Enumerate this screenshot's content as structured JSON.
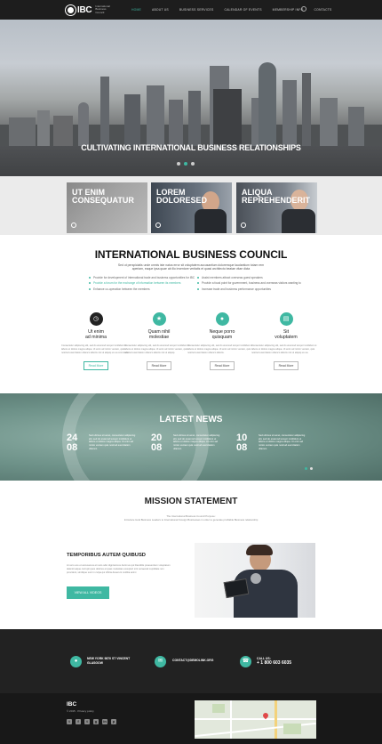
{
  "header": {
    "logo_text": "IBC",
    "logo_sub": "International Business Council",
    "nav": [
      "Home",
      "About us",
      "Business services",
      "Calendar of events",
      "Membership info",
      "Contacts"
    ]
  },
  "hero": {
    "caption": "CULTIVATING INTERNATIONAL BUSINESS RELATIONSHIPS"
  },
  "cards": [
    {
      "line1": "UT ENIM",
      "line2": "CONSEQUATUR"
    },
    {
      "line1": "LOREM",
      "line2": "DOLORESED"
    },
    {
      "line1": "ALIQUA",
      "line2": "REPREHENDERIT"
    }
  ],
  "intro": {
    "title": "INTERNATIONAL BUSINESS COUNCIL",
    "text": "Sed ut perspiciatis unde omnis iste natus error sit voluptatem accusantium doloremque laudantium totam rem aperiam, eaque ipsa quae ab illo inventore veritatis et quasi architecto beatae vitae dicta",
    "left_list": [
      "Provide for development of international trade and business opportunities for IBC",
      "Provide a forum for the exchange of information between its members",
      "Enhance co-operation between the members"
    ],
    "right_list": [
      "Assist members attract overseas guest speakers",
      "Provide a focal point for government, business and overseas visitors wanting to",
      "Increase trade and business performance opportunities"
    ]
  },
  "features": [
    {
      "title": "Ut enim\nad minima",
      "text": "Consectetur adipiscing elit, sed do eiusmod tempor incididunt ut labore et dolore magna aliqua. Ut enim ad minim veniam, quis nostrud exercitation ullamco laboris nisi ut aliquip ex ea commodo.",
      "btn": "Read More"
    },
    {
      "title": "Quam nihil\nmolestiae",
      "text": "Consectetur adipiscing elit, sed do eiusmod tempor incididunt ut labore et dolore magna aliqua. Ut enim ad minim veniam, quis nostrud exercitation ullamco laboris nisi ut aliquip.",
      "btn": "Read More"
    },
    {
      "title": "Neque porro\nquisquam",
      "text": "Consectetur adipiscing elit, sed do eiusmod tempor incididunt ut labore et dolore magna aliqua. Ut enim ad minim veniam, quis nostrud exercitation ullamco laboris.",
      "btn": "Read More"
    },
    {
      "title": "Sit\nvoluptatem",
      "text": "Consectetur adipiscing elit, sed do eiusmod tempor incididunt ut labore et dolore magna aliqua. Ut enim ad minim veniam, quis nostrud exercitation ullamco laboris nisi ut aliquip ex ea.",
      "btn": "Read More"
    }
  ],
  "news": {
    "title": "LATEST NEWS",
    "items": [
      {
        "day": "24",
        "month": "08",
        "text": "Sed ultrices sit amet, consectetur adipiscing elit, sed do eiusmod tempor incididunt ut labore et dolore magna aliqua. Ut enim ad minim veniam quis nostrud exercitation ullamco"
      },
      {
        "day": "20",
        "month": "08",
        "text": "Sed ultrices sit amet, consectetur adipiscing elit, sed do eiusmod tempor incididunt ut labore et dolore magna aliqua. Ut enim ad minim veniam quis nostrud exercitation ullamco"
      },
      {
        "day": "10",
        "month": "08",
        "text": "Sed ultrices sit amet, consectetur adipiscing elit, sed do eiusmod tempor incididunt ut labore et dolore magna aliqua. Ut enim ad minim veniam quis nostrud exercitation ullamco"
      }
    ]
  },
  "mission": {
    "title": "MISSION STATEMENT",
    "sub1": "The International Business Council Purpose:",
    "sub2": "Introduce local Business Leaders to International Foreign Businesses in order to generate profitable Business relationship"
  },
  "temporibus": {
    "title": "TEMPORIBUS AUTEM QUIBUSD",
    "text": "At vero eos et accusamus et iusto odio dignissimos ducimus qui blanditiis praesentium voluptatum deleniti atque corrupti quos dolores et quas molestias excepturi sint occaecati cupiditate non provident, similique sunt in culpa qui officia deserunt mollitia animi",
    "btn": "View all videos"
  },
  "contacts": [
    {
      "icon": "location-icon",
      "line1": "NEW YORK 9870 ST VINCENT",
      "line2": "GLASGOW"
    },
    {
      "icon": "mail-icon",
      "line1": "CONTACT@DEMOLINK.ORG",
      "line2": ""
    },
    {
      "icon": "phone-icon",
      "line1": "CALL US:",
      "line2": "+ 1 800 603 6035"
    }
  ],
  "footer": {
    "logo": "IBC",
    "copy": "© 2015 · Privacy policy",
    "social": [
      "t",
      "f",
      "t",
      "g",
      "in",
      "p"
    ]
  },
  "colors": {
    "accent": "#3fb8a2",
    "dark": "#1d1d1d"
  }
}
